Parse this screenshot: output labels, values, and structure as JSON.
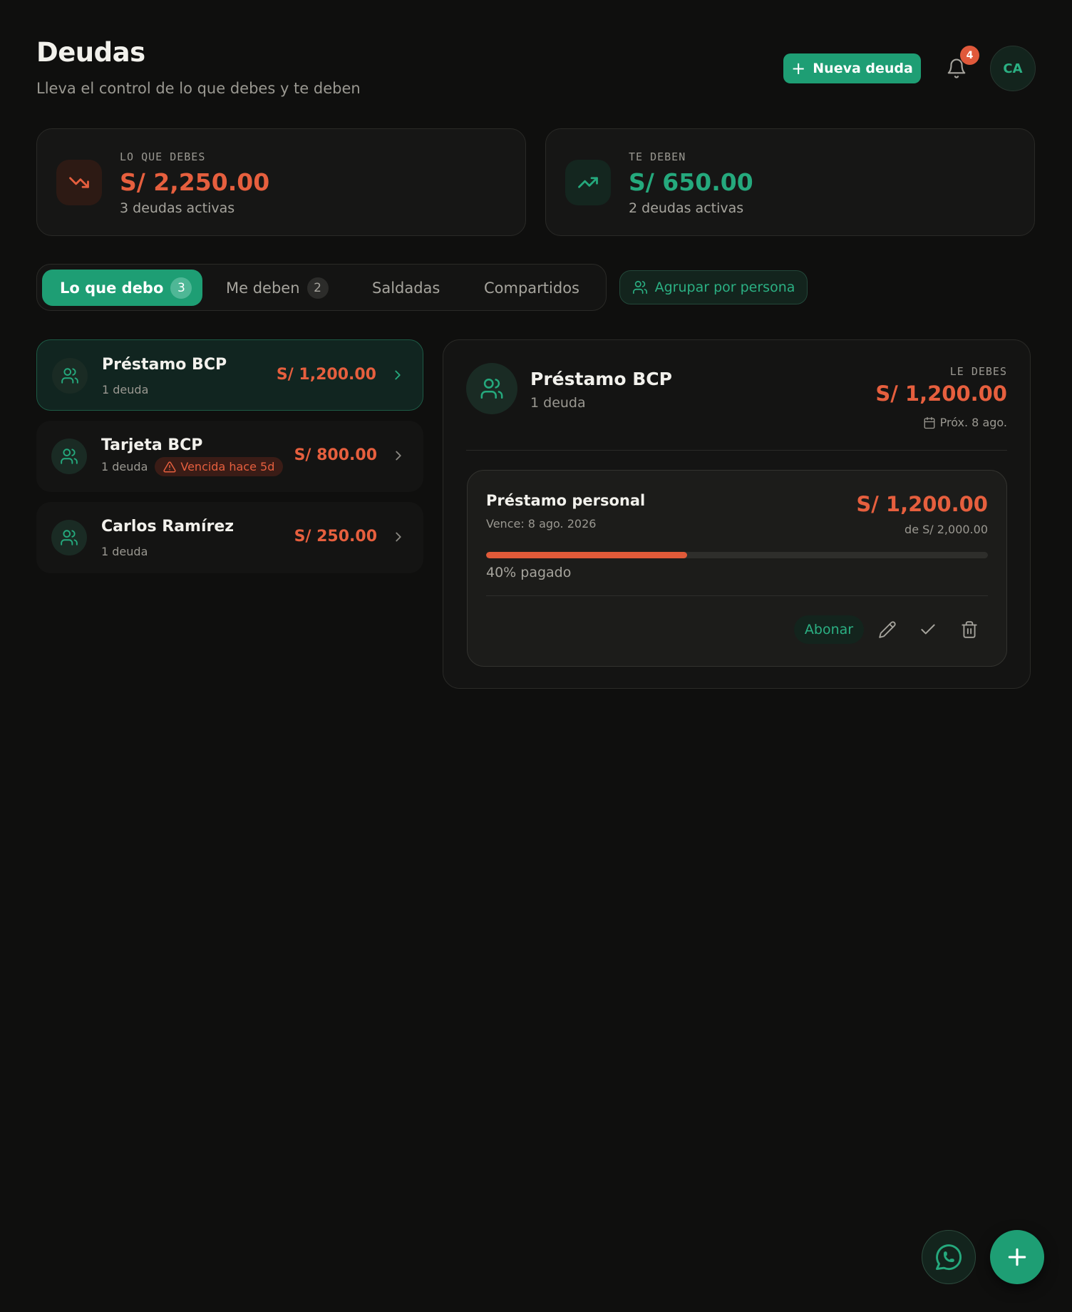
{
  "header": {
    "title": "Deudas",
    "subtitle": "Lleva el control de lo que debes y te deben",
    "new_button_label": "Nueva deuda",
    "notifications_count": "4",
    "avatar_initials": "CA"
  },
  "stats": {
    "owe": {
      "label": "LO QUE DEBES",
      "amount": "S/ 2,250.00",
      "sub": "3 deudas activas",
      "icon": "trending-down-icon"
    },
    "owed": {
      "label": "TE DEBEN",
      "amount": "S/ 650.00",
      "sub": "2 deudas activas",
      "icon": "trending-up-icon"
    }
  },
  "tabs": [
    {
      "label": "Lo que debo",
      "count": "3",
      "active": true
    },
    {
      "label": "Me deben",
      "count": "2",
      "active": false
    },
    {
      "label": "Saldadas",
      "active": false
    },
    {
      "label": "Compartidos",
      "active": false
    }
  ],
  "group_button_label": "Agrupar por persona",
  "list": [
    {
      "name": "Préstamo BCP",
      "sub": "1 deuda",
      "amount": "S/ 1,200.00",
      "selected": true
    },
    {
      "name": "Tarjeta BCP",
      "sub": "1 deuda",
      "badge": "Vencida hace 5d",
      "amount": "S/ 800.00",
      "selected": false
    },
    {
      "name": "Carlos Ramírez",
      "sub": "1 deuda",
      "amount": "S/ 250.00",
      "selected": false
    }
  ],
  "detail": {
    "name": "Préstamo BCP",
    "sub": "1 deuda",
    "label": "LE DEBES",
    "amount": "S/ 1,200.00",
    "next_date": "Próx. 8 ago.",
    "debt": {
      "title": "Préstamo personal",
      "due": "Vence: 8 ago. 2026",
      "amount": "S/ 1,200.00",
      "of_total": "de S/ 2,000.00",
      "paid_percent": 40,
      "progress_text": "40% pagado",
      "pay_button_label": "Abonar"
    }
  },
  "colors": {
    "accent": "#1e9e74",
    "danger": "#e65f3e",
    "background": "#0f0f0e"
  }
}
